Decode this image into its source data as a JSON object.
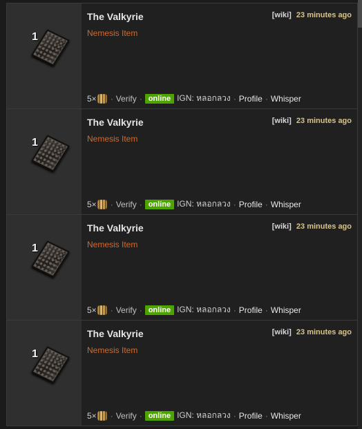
{
  "listings": [
    {
      "item_name": "The Valkyrie",
      "stack_size": "1",
      "item_icon": "divination-card-icon",
      "wiki_label": "[wiki]",
      "time_ago": "23 minutes ago",
      "modifier": "Nemesis Item",
      "price_amount": "5×",
      "currency_icon": "currency-orb-icon",
      "verify_label": "Verify",
      "status_label": "online",
      "ign_label": "IGN: หลอกลวง",
      "profile_label": "Profile",
      "whisper_label": "Whisper"
    },
    {
      "item_name": "The Valkyrie",
      "stack_size": "1",
      "item_icon": "divination-card-icon",
      "wiki_label": "[wiki]",
      "time_ago": "23 minutes ago",
      "modifier": "Nemesis Item",
      "price_amount": "5×",
      "currency_icon": "currency-orb-icon",
      "verify_label": "Verify",
      "status_label": "online",
      "ign_label": "IGN: หลอกลวง",
      "profile_label": "Profile",
      "whisper_label": "Whisper"
    },
    {
      "item_name": "The Valkyrie",
      "stack_size": "1",
      "item_icon": "divination-card-icon",
      "wiki_label": "[wiki]",
      "time_ago": "23 minutes ago",
      "modifier": "Nemesis Item",
      "price_amount": "5×",
      "currency_icon": "currency-orb-icon",
      "verify_label": "Verify",
      "status_label": "online",
      "ign_label": "IGN: หลอกลวง",
      "profile_label": "Profile",
      "whisper_label": "Whisper"
    },
    {
      "item_name": "The Valkyrie",
      "stack_size": "1",
      "item_icon": "divination-card-icon",
      "wiki_label": "[wiki]",
      "time_ago": "23 minutes ago",
      "modifier": "Nemesis Item",
      "price_amount": "5×",
      "currency_icon": "currency-orb-icon",
      "verify_label": "Verify",
      "status_label": "online",
      "ign_label": "IGN: หลอกลวง",
      "profile_label": "Profile",
      "whisper_label": "Whisper"
    }
  ],
  "colors": {
    "modifier": "#d16a2d",
    "online_badge": "#4da400",
    "time": "#d8c48a"
  }
}
